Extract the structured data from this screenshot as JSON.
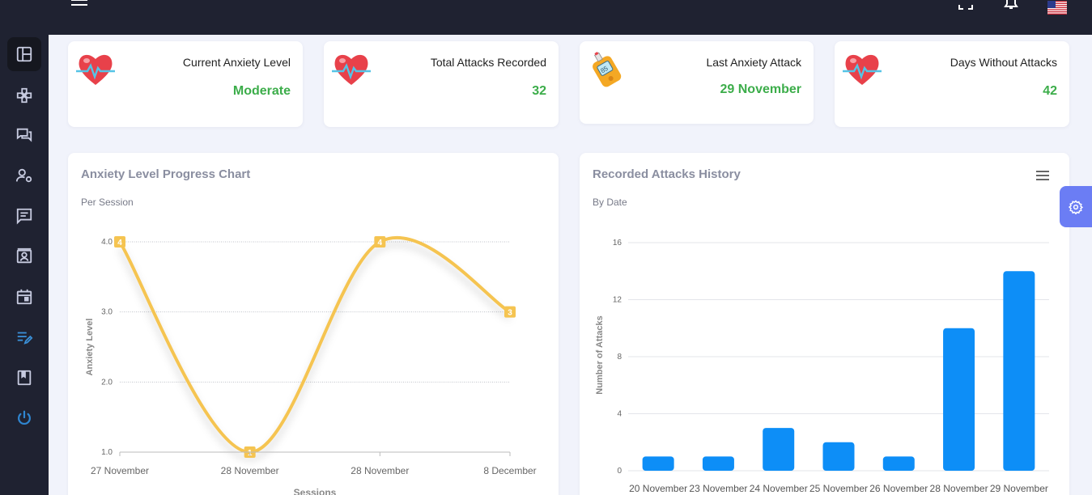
{
  "sidebar": {
    "items": [
      {
        "name": "sidebar-item-dashboard",
        "icon": "dashboard-icon",
        "active": true
      },
      {
        "name": "sidebar-item-games",
        "icon": "gamepad-icon"
      },
      {
        "name": "sidebar-item-chat",
        "icon": "chat-bubbles-icon"
      },
      {
        "name": "sidebar-item-user-settings",
        "icon": "user-gear-icon"
      },
      {
        "name": "sidebar-item-messages",
        "icon": "message-icon"
      },
      {
        "name": "sidebar-item-contacts",
        "icon": "contact-card-icon"
      },
      {
        "name": "sidebar-item-calendar",
        "icon": "calendar-icon"
      },
      {
        "name": "sidebar-item-notes",
        "icon": "edit-list-icon"
      },
      {
        "name": "sidebar-item-journal",
        "icon": "book-icon"
      },
      {
        "name": "sidebar-item-logout",
        "icon": "power-icon"
      }
    ]
  },
  "stats": [
    {
      "label": "Current Anxiety Level",
      "value": "Moderate",
      "icon": "heart-pulse-icon"
    },
    {
      "label": "Total Attacks Recorded",
      "value": "32",
      "icon": "heart-pulse-icon"
    },
    {
      "label": "Last Anxiety Attack",
      "value": "29 November",
      "icon": "glucose-meter-icon"
    },
    {
      "label": "Days Without Attacks",
      "value": "42",
      "icon": "heart-pulse-icon"
    }
  ],
  "colors": {
    "accent_green": "#3cad4a",
    "line_yellow": "#f5c451",
    "bar_blue": "#0d8ef7",
    "sidebar_bg": "#1f2231",
    "fab_blue": "#6b7df4"
  },
  "chart_data": [
    {
      "type": "line",
      "title": "Anxiety Level Progress Chart",
      "subtitle": "Per Session",
      "xlabel": "Sessions",
      "ylabel": "Anxiety Level",
      "categories": [
        "27 November",
        "28 November",
        "28 November",
        "8 December"
      ],
      "values": [
        4,
        1,
        4,
        3
      ],
      "data_labels": [
        "4",
        "1",
        "4",
        "3"
      ],
      "ylim": [
        1,
        4
      ],
      "yticks": [
        "1.0",
        "2.0",
        "3.0",
        "4.0"
      ],
      "grid": true,
      "smooth": true
    },
    {
      "type": "bar",
      "title": "Recorded Attacks History",
      "subtitle": "By Date",
      "ylabel": "Number of Attacks",
      "categories": [
        "20 November",
        "23 November",
        "24 November",
        "25 November",
        "26 November",
        "28 November",
        "29 November"
      ],
      "values": [
        1,
        1,
        3,
        2,
        1,
        10,
        14
      ],
      "ylim": [
        0,
        16
      ],
      "yticks": [
        "0",
        "4",
        "8",
        "12",
        "16"
      ],
      "grid": true
    }
  ]
}
